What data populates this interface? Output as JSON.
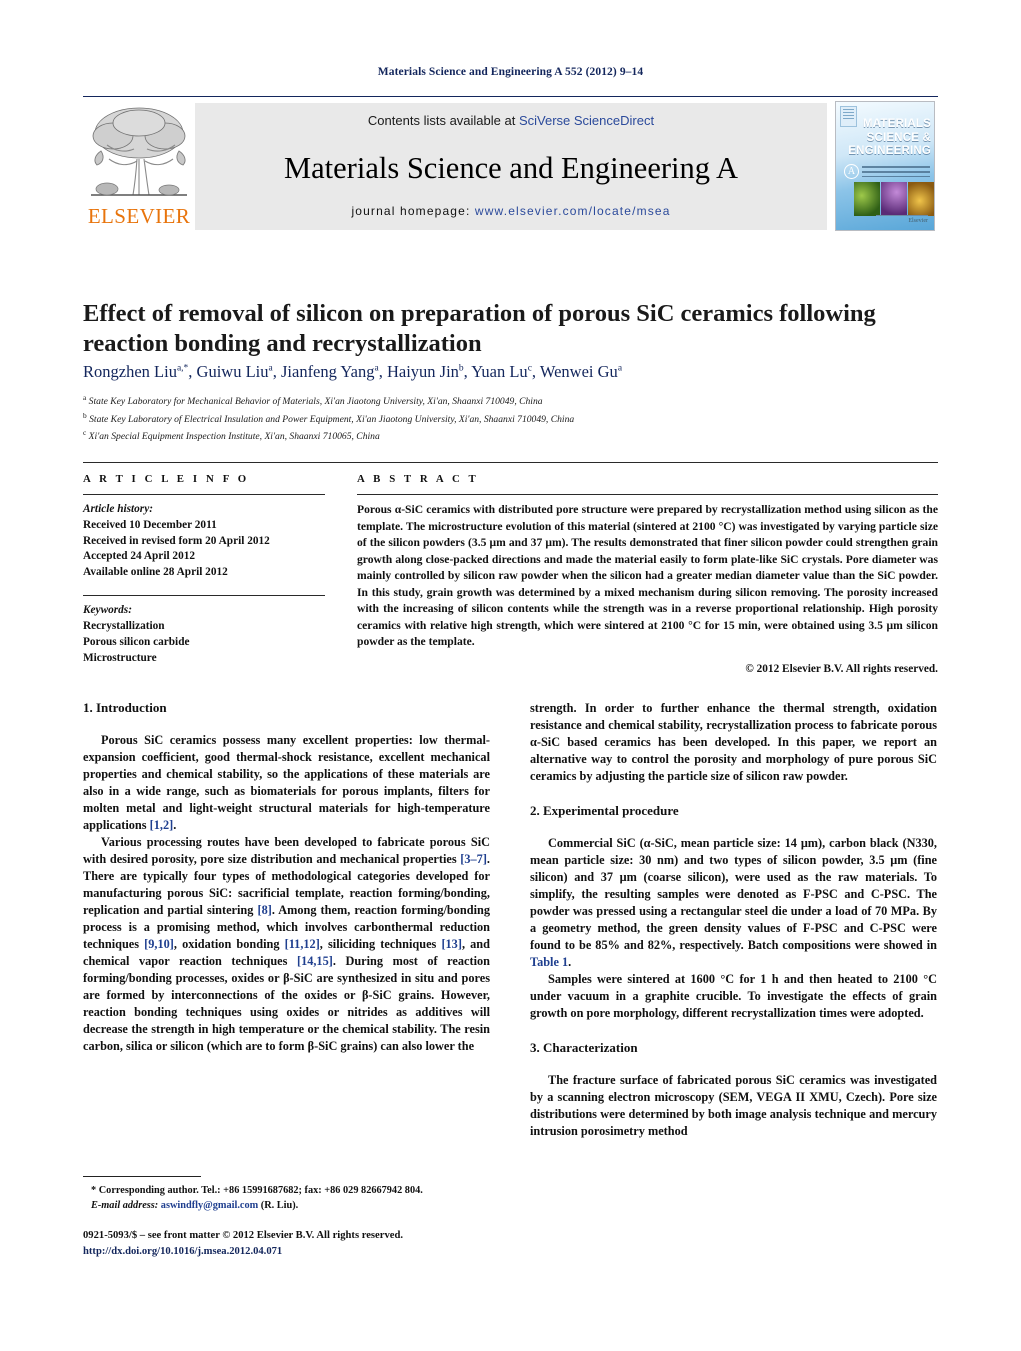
{
  "running_head": "Materials Science and Engineering A 552 (2012) 9–14",
  "banner": {
    "contents_prefix": "Contents lists available at ",
    "contents_link": "SciVerse ScienceDirect",
    "journal_title": "Materials Science and Engineering A",
    "homepage_prefix": "journal homepage: ",
    "homepage_url": "www.elsevier.com/locate/msea",
    "publisher_wordmark": "ELSEVIER",
    "publisher_logo_name": "elsevier-tree-logo",
    "cover": {
      "line1": "MATERIALS",
      "line2": "SCIENCE &",
      "line3": "ENGINEERING",
      "badge": "A",
      "footer": "Elsevier"
    },
    "link_color": "#2b4a9b",
    "brand_color": "#e8740c",
    "rule_color": "#13265c"
  },
  "article": {
    "title": "Effect of removal of silicon on preparation of porous SiC ceramics following reaction bonding and recrystallization",
    "authors_html": "Rongzhen Liu<sup>a,*</sup>, Guiwu Liu<sup>a</sup>, Jianfeng Yang<sup>a</sup>, Haiyun Jin<sup>b</sup>, Yuan Lu<sup>c</sup>, Wenwei Gu<sup>a</sup>",
    "affiliations": [
      {
        "mark": "a",
        "text": "State Key Laboratory for Mechanical Behavior of Materials, Xi'an Jiaotong University, Xi'an, Shaanxi 710049, China"
      },
      {
        "mark": "b",
        "text": "State Key Laboratory of Electrical Insulation and Power Equipment, Xi'an Jiaotong University, Xi'an, Shaanxi 710049, China"
      },
      {
        "mark": "c",
        "text": "Xi'an Special Equipment Inspection Institute, Xi'an, Shaanxi 710065, China"
      }
    ]
  },
  "article_info": {
    "heading": "A R T I C L E    I N F O",
    "history_label": "Article history:",
    "history": [
      "Received 10 December 2011",
      "Received in revised form 20 April 2012",
      "Accepted 24 April 2012",
      "Available online 28 April 2012"
    ],
    "keywords_label": "Keywords:",
    "keywords": [
      "Recrystallization",
      "Porous silicon carbide",
      "Microstructure"
    ]
  },
  "abstract": {
    "heading": "A B S T R A C T",
    "text": "Porous α-SiC ceramics with distributed pore structure were prepared by recrystallization method using silicon as the template. The microstructure evolution of this material (sintered at 2100 °C) was investigated by varying particle size of the silicon powders (3.5 μm and 37 μm). The results demonstrated that finer silicon powder could strengthen grain growth along close-packed directions and made the material easily to form plate-like SiC crystals. Pore diameter was mainly controlled by silicon raw powder when the silicon had a greater median diameter value than the SiC powder. In this study, grain growth was determined by a mixed mechanism during silicon removing. The porosity increased with the increasing of silicon contents while the strength was in a reverse proportional relationship. High porosity ceramics with relative high strength, which were sintered at 2100 °C for 15 min, were obtained using 3.5 μm silicon powder as the template.",
    "copyright": "© 2012 Elsevier B.V. All rights reserved."
  },
  "sections": {
    "introduction": {
      "heading": "1.  Introduction",
      "para1_a": "Porous SiC ceramics possess many excellent properties: low thermal-expansion coefficient, good thermal-shock resistance, excellent mechanical properties and chemical stability, so the applications of these materials are also in a wide range, such as biomaterials for porous implants, filters for molten metal and light-weight structural materials for high-temperature applications ",
      "para1_ref": "[1,2]",
      "para1_b": ".",
      "para2_a": "Various processing routes have been developed to fabricate porous SiC with desired porosity, pore size distribution and mechanical properties ",
      "para2_ref1": "[3–7]",
      "para2_b": ". There are typically four types of methodological categories developed for manufacturing porous SiC: sacrificial template, reaction forming/bonding, replication and partial sintering ",
      "para2_ref2": "[8]",
      "para2_c": ". Among them, reaction forming/bonding process is a promising method, which involves carbonthermal reduction techniques ",
      "para2_ref3": "[9,10]",
      "para2_d": ", oxidation bonding ",
      "para2_ref4": "[11,12]",
      "para2_e": ", siliciding techniques ",
      "para2_ref5": "[13]",
      "para2_f": ", and chemical vapor reaction techniques ",
      "para2_ref6": "[14,15]",
      "para2_g": ". During most of reaction forming/bonding processes, oxides or β-SiC are synthesized in situ and pores are formed by interconnections of the oxides or β-SiC grains. However, reaction bonding techniques using oxides or nitrides as additives will decrease the strength in high temperature or the chemical stability. The resin carbon, silica or silicon (which are to form β-SiC grains) can also lower the",
      "para3": "strength. In order to further enhance the thermal strength, oxidation resistance and chemical stability, recrystallization process to fabricate porous α-SiC based ceramics has been developed. In this paper, we report an alternative way to control the porosity and morphology of pure porous SiC ceramics by adjusting the particle size of silicon raw powder."
    },
    "experimental": {
      "heading": "2.  Experimental procedure",
      "para1_a": "Commercial SiC (α-SiC, mean particle size: 14 μm), carbon black (N330, mean particle size: 30 nm) and two types of silicon powder, 3.5 μm (fine silicon) and 37 μm (coarse silicon), were used as the raw materials. To simplify, the resulting samples were denoted as F-PSC and C-PSC. The powder was pressed using a rectangular steel die under a load of 70 MPa. By a geometry method, the green density values of F-PSC and C-PSC were found to be 85% and 82%, respectively. Batch compositions were showed in ",
      "para1_link": "Table 1",
      "para1_b": ".",
      "para2": "Samples were sintered at 1600 °C for 1 h and then heated to 2100 °C under vacuum in a graphite crucible. To investigate the effects of grain growth on pore morphology, different recrystallization times were adopted."
    },
    "characterization": {
      "heading": "3.  Characterization",
      "para1": "The fracture surface of fabricated porous SiC ceramics was investigated by a scanning electron microscopy (SEM, VEGA II XMU, Czech). Pore size distributions were determined by both image analysis technique and mercury intrusion porosimetry method"
    }
  },
  "footnote": {
    "marker": "*",
    "corresponding": " Corresponding author. Tel.: +86 15991687682; fax: +86 029 82667942 804.",
    "email_label": "E-mail address: ",
    "email": "aswindfly@gmail.com",
    "email_suffix": " (R. Liu)."
  },
  "footer": {
    "issn_line": "0921-5093/$ – see front matter © 2012 Elsevier B.V. All rights reserved.",
    "doi": "http://dx.doi.org/10.1016/j.msea.2012.04.071"
  }
}
